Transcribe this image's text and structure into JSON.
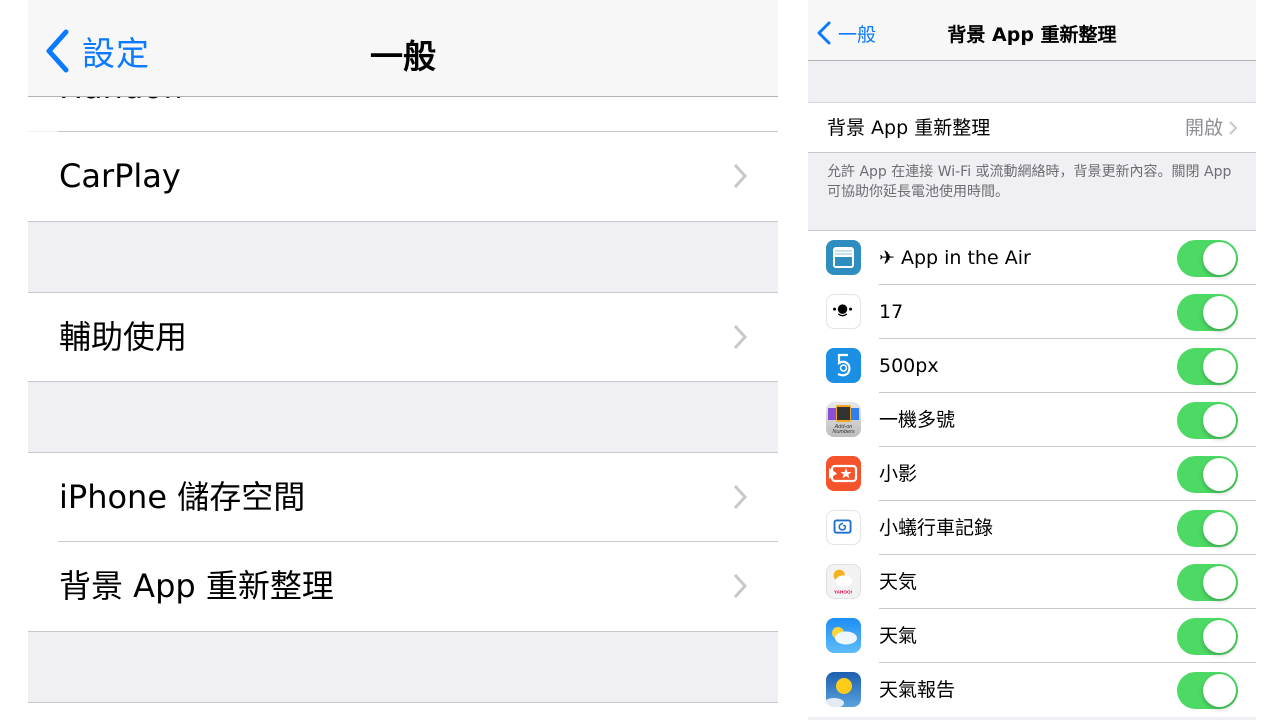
{
  "left": {
    "nav": {
      "back_label": "設定",
      "title": "一般"
    },
    "peek_item": {
      "label": "Handoff"
    },
    "rows": [
      {
        "label": "CarPlay"
      },
      {
        "label": "輔助使用"
      },
      {
        "label": "iPhone 儲存空間"
      },
      {
        "label": "背景 App 重新整理"
      }
    ]
  },
  "right": {
    "nav": {
      "back_label": "一般",
      "title": "背景 App 重新整理"
    },
    "master": {
      "label": "背景 App 重新整理",
      "value": "開啟"
    },
    "footer": "允許 App 在連接 Wi-Fi 或流動網絡時，背景更新內容。關閉 App 可協助你延長電池使用時間。",
    "apps": [
      {
        "name": "✈ App in the Air",
        "icon": "app-in-the-air-icon",
        "enabled": true
      },
      {
        "name": "17",
        "icon": "17-app-icon",
        "enabled": true
      },
      {
        "name": "500px",
        "icon": "500px-icon",
        "enabled": true
      },
      {
        "name": "一機多號",
        "icon": "add-on-numbers-icon",
        "enabled": true
      },
      {
        "name": "小影",
        "icon": "vivavideo-icon",
        "enabled": true
      },
      {
        "name": "小蟻行車記錄",
        "icon": "yi-dashcam-icon",
        "enabled": true
      },
      {
        "name": "天気",
        "icon": "yahoo-weather-icon",
        "enabled": true
      },
      {
        "name": "天氣",
        "icon": "weather-icon",
        "enabled": true
      },
      {
        "name": "天氣報告",
        "icon": "weather-report-icon",
        "enabled": true
      }
    ],
    "colors": {
      "accent": "#0a7aff",
      "toggle_on": "#4cd964"
    }
  }
}
